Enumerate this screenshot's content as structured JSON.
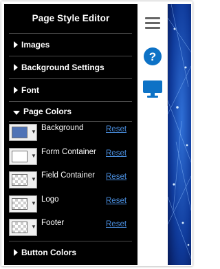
{
  "editor": {
    "title": "Page Style Editor",
    "sections": {
      "images": "Images",
      "background_settings": "Background Settings",
      "font": "Font",
      "page_colors": "Page Colors",
      "button_colors": "Button Colors"
    },
    "page_colors": {
      "rows": [
        {
          "label": "Background",
          "reset": "Reset",
          "color": "#4f73b6"
        },
        {
          "label": "Form Container",
          "reset": "Reset",
          "color": "#ffffff"
        },
        {
          "label": "Field Container",
          "reset": "Reset",
          "color": "transparent"
        },
        {
          "label": "Logo",
          "reset": "Reset",
          "color": "transparent"
        },
        {
          "label": "Footer",
          "reset": "Reset",
          "color": "transparent"
        }
      ]
    }
  },
  "toolbar": {
    "icons": [
      "menu-icon",
      "help-icon",
      "desktop-icon"
    ],
    "accent": "#0d72c6"
  },
  "colors": {
    "panel_bg": "#000000",
    "link": "#4a8fe0",
    "page_background": "#0a2a8a"
  }
}
